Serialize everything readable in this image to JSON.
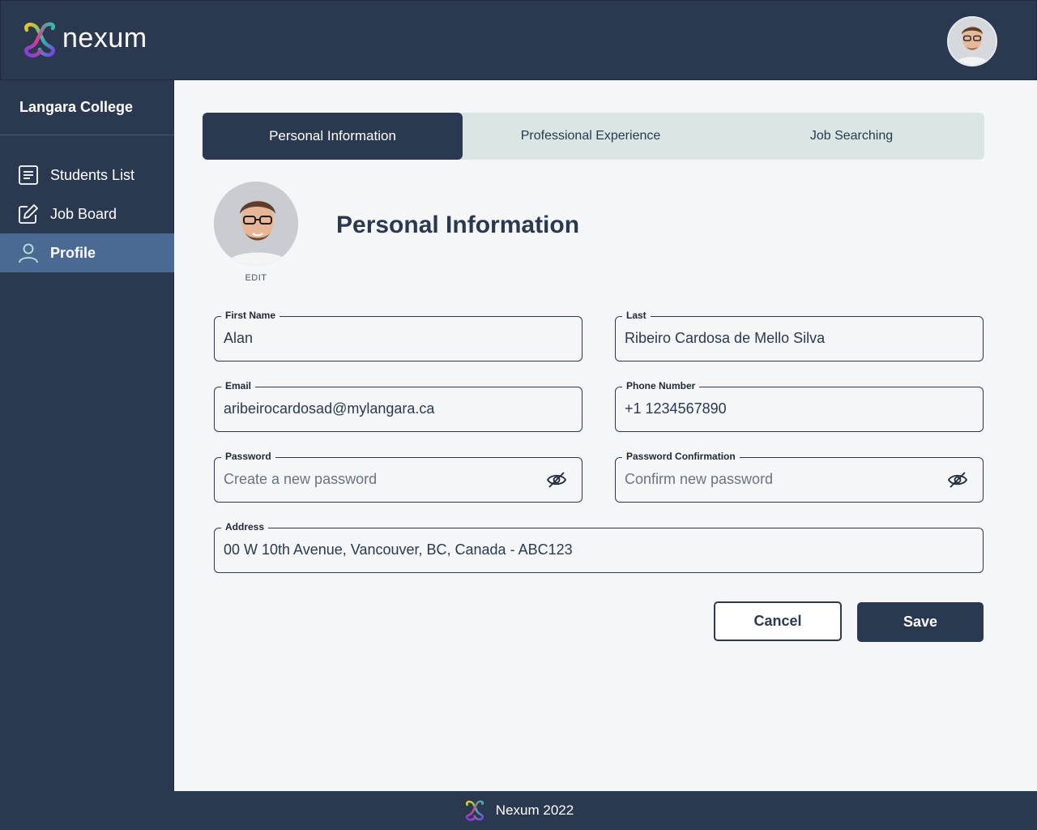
{
  "app": {
    "name": "nexum",
    "logo_icon": "nexum-logo-icon"
  },
  "header": {
    "avatar_icon": "user-avatar"
  },
  "sidebar": {
    "organization": "Langara College",
    "items": [
      {
        "label": "Students List",
        "icon": "list-document-icon",
        "active": false
      },
      {
        "label": "Job Board",
        "icon": "edit-pencil-icon",
        "active": false
      },
      {
        "label": "Profile",
        "icon": "user-icon",
        "active": true
      }
    ]
  },
  "tabs": [
    {
      "label": "Personal Information",
      "active": true
    },
    {
      "label": "Professional Experience",
      "active": false
    },
    {
      "label": "Job Searching",
      "active": false
    }
  ],
  "profile": {
    "edit_label": "EDIT",
    "section_title": "Personal Information"
  },
  "form": {
    "first_name": {
      "label": "First Name",
      "value": "Alan"
    },
    "last_name": {
      "label": "Last",
      "value": "Ribeiro Cardosa de Mello Silva"
    },
    "email": {
      "label": "Email",
      "value": "aribeirocardosad@mylangara.ca"
    },
    "phone": {
      "label": "Phone Number",
      "value": "+1 1234567890"
    },
    "password": {
      "label": "Password",
      "placeholder": "Create a new password",
      "value": ""
    },
    "password_confirmation": {
      "label": "Password Confirmation",
      "placeholder": "Confirm new password",
      "value": ""
    },
    "address": {
      "label": "Address",
      "value": "00 W 10th Avenue, Vancouver, BC, Canada - ABC123"
    }
  },
  "actions": {
    "cancel_label": "Cancel",
    "save_label": "Save"
  },
  "footer": {
    "text": "Nexum 2022"
  },
  "colors": {
    "primary": "#2b3950",
    "active_nav": "#4a6a93",
    "tab_bg": "#d9e6e4",
    "content_bg": "#f4f6f8"
  }
}
